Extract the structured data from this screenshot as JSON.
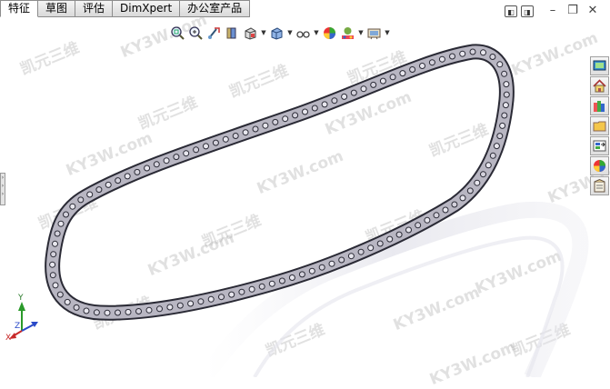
{
  "tabs": [
    {
      "label": "特征",
      "active": true
    },
    {
      "label": "草图",
      "active": false
    },
    {
      "label": "评估",
      "active": false
    },
    {
      "label": "DimXpert",
      "active": false
    },
    {
      "label": "办公室产品",
      "active": false
    }
  ],
  "hud_icons": [
    "zoom-to-fit-icon",
    "zoom-area-icon",
    "previous-view-icon",
    "section-view-icon",
    "view-orientation-icon",
    "display-style-icon",
    "hide-show-items-icon",
    "edit-appearance-icon",
    "apply-scene-icon",
    "view-settings-icon"
  ],
  "task_pane_icons": [
    "solidworks-resources-icon",
    "home-icon",
    "design-library-icon",
    "file-explorer-icon",
    "view-palette-icon",
    "appearances-icon",
    "custom-properties-icon"
  ],
  "triad": {
    "x": "X",
    "y": "Y",
    "z": "Z"
  },
  "watermark": [
    "凯元三维",
    "KY3W.com"
  ],
  "colors": {
    "chain_link": "#b8b6c2",
    "chain_edge": "#2a2a35",
    "tab_active": "#ffffff"
  }
}
